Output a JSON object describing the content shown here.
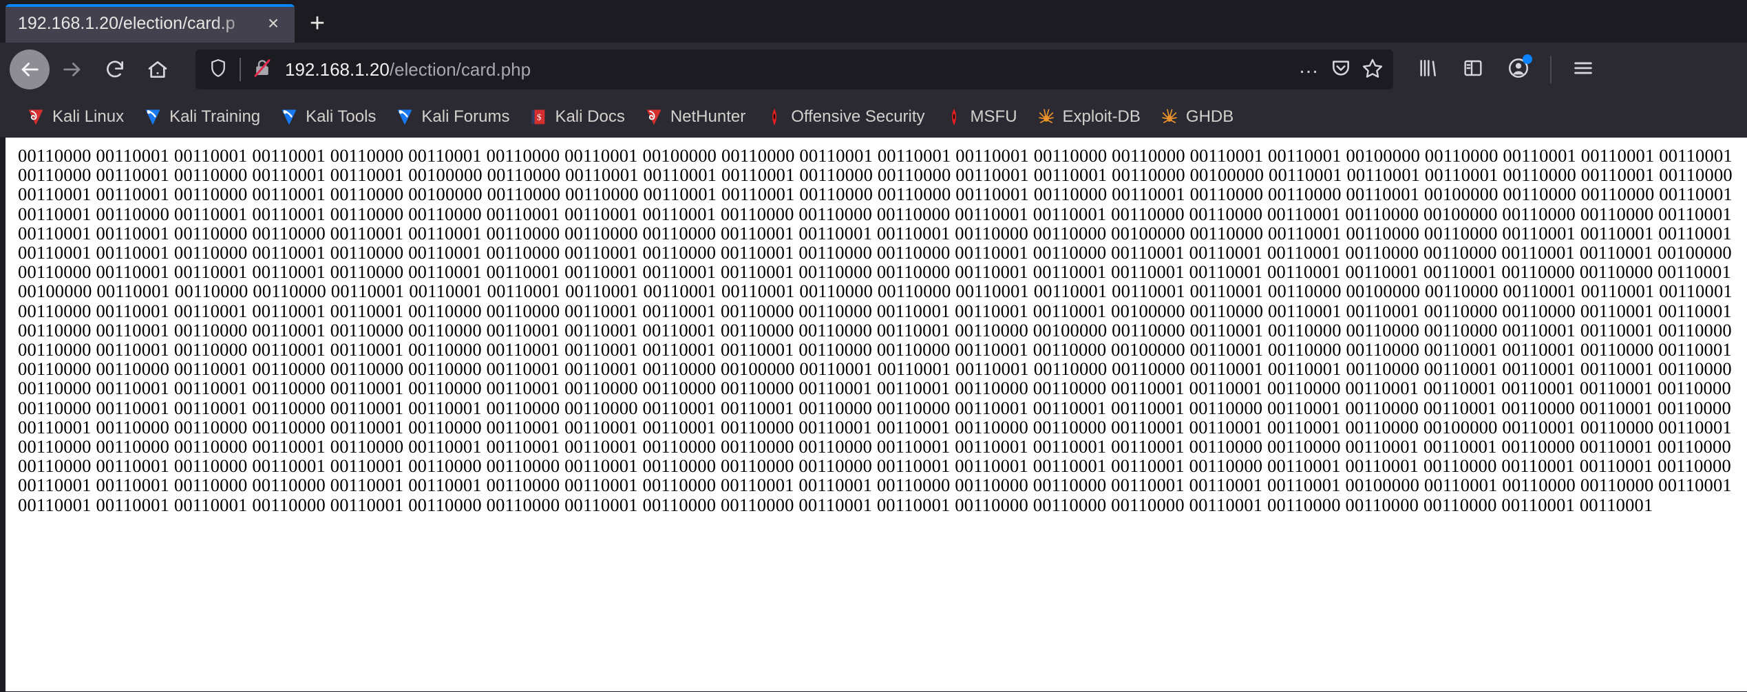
{
  "browser": {
    "tab": {
      "title": "192.168.1.20/election/card.p",
      "close_label": "×"
    },
    "new_tab_label": "+",
    "nav": {
      "back": "Back",
      "forward": "Forward",
      "reload": "Reload",
      "home": "Home"
    },
    "url": {
      "host": "192.168.1.20",
      "path": "/election/card.php",
      "page_actions_label": "…",
      "shield_icon": "shield-icon",
      "insecure_icon": "broken-lock-icon",
      "pocket_icon": "pocket-icon",
      "bookmark_icon": "star-icon"
    },
    "tools": {
      "library_icon": "library-icon",
      "sidebar_icon": "sidebar-icon",
      "account_icon": "account-avatar-icon",
      "menu_icon": "hamburger-menu-icon"
    },
    "accent_color": "#0a84ff",
    "chrome_color": "#2b2a33",
    "tab_color": "#42414d"
  },
  "bookmarks": [
    {
      "label": "Kali Linux",
      "icon": "kali-dragon-red-icon",
      "color": "#d32f2f"
    },
    {
      "label": "Kali Training",
      "icon": "kali-dragon-blue-icon",
      "color": "#1878f0"
    },
    {
      "label": "Kali Tools",
      "icon": "kali-dragon-blue-icon",
      "color": "#1878f0"
    },
    {
      "label": "Kali Forums",
      "icon": "kali-dragon-blue-icon",
      "color": "#1878f0"
    },
    {
      "label": "Kali Docs",
      "icon": "kali-docs-book-icon",
      "color": "#d32f2f"
    },
    {
      "label": "NetHunter",
      "icon": "kali-dragon-red-icon",
      "color": "#d32f2f"
    },
    {
      "label": "Offensive Security",
      "icon": "offsec-flame-icon",
      "color": "#e02020"
    },
    {
      "label": "MSFU",
      "icon": "offsec-flame-icon",
      "color": "#e02020"
    },
    {
      "label": "Exploit-DB",
      "icon": "exploitdb-spider-icon",
      "color": "#e8912a"
    },
    {
      "label": "GHDB",
      "icon": "exploitdb-spider-icon",
      "color": "#e8912a"
    }
  ],
  "page": {
    "content_type": "binary-text-dump",
    "text_color": "#000000",
    "background_color": "#ffffff",
    "binary_dump": "00110000 00110001 00110001 00110001 00110000 00110001 00110000 00110001 00100000 00110000 00110001 00110001 00110001 00110000 00110000 00110001 00110001 00100000 00110000 00110001 00110001 00110001 00110000 00110001 00110000 00110001 00110001 00100000 00110000 00110001 00110001 00110001 00110000 00110000 00110001 00110001 00110000 00100000 00110001 00110001 00110001 00110000 00110001 00110000 00110001 00110001 00110000 00110001 00110000 00100000 00110000 00110000 00110001 00110001 00110000 00110000 00110001 00110000 00110001 00110000 00110000 00110001 00100000 00110000 00110000 00110001 00110001 00110000 00110001 00110001 00110000 00110000 00110001 00110001 00110001 00110000 00110000 00110000 00110001 00110001 00110000 00110000 00110001 00110000 00100000 00110000 00110000 00110001 00110001 00110001 00110000 00110000 00110001 00110001 00110000 00110000 00110000 00110001 00110001 00110001 00110000 00110000 00100000 00110000 00110001 00110000 00110000 00110001 00110001 00110001 00110001 00110001 00110000 00110001 00110000 00110001 00110000 00110001 00110000 00110001 00110000 00110000 00110001 00110000 00110001 00110001 00110001 00110000 00110000 00110001 00110001 00100000 00110000 00110001 00110001 00110001 00110000 00110001 00110001 00110001 00110001 00110001 00110000 00110000 00110001 00110001 00110001 00110001 00110001 00110001 00110001 00110000 00110000 00110001 00100000 00110001 00110000 00110000 00110001 00110001 00110001 00110001 00110001 00110001 00110000 00110000 00110001 00110001 00110001 00110001 00110000 00100000 00110000 00110001 00110001 00110001 00110000 00110001 00110001 00110001 00110001 00110000 00110000 00110001 00110001 00110000 00110000 00110001 00110001 00110001 00100000 00110000 00110001 00110001 00110000 00110000 00110001 00110001 00110000 00110001 00110000 00110001 00110000 00110000 00110001 00110001 00110001 00110000 00110000 00110001 00110000 00100000 00110000 00110001 00110000 00110000 00110000 00110001 00110001 00110000 00110000 00110001 00110000 00110001 00110001 00110000 00110001 00110001 00110001 00110001 00110000 00110000 00110001 00110000 00100000 00110001 00110000 00110000 00110001 00110001 00110000 00110001 00110000 00110000 00110001 00110000 00110000 00110000 00110001 00110001 00110000 00100000 00110001 00110001 00110001 00110000 00110000 00110001 00110001 00110000 00110001 00110001 00110001 00110000 00110000 00110001 00110001 00110000 00110001 00110000 00110001 00110000 00110000 00110000 00110001 00110001 00110000 00110000 00110001 00110001 00110000 00110001 00110001 00110001 00110001 00110000 00110000 00110001 00110001 00110000 00110001 00110001 00110000 00110000 00110001 00110001 00110000 00110000 00110001 00110001 00110001 00110000 00110001 00110000 00110001 00110000 00110001 00110000 00110001 00110000 00110000 00110000 00110001 00110000 00110001 00110001 00110001 00110000 00110001 00110001 00110000 00110000 00110001 00110001 00110001 00110000 00100000 00110001 00110000 00110001 00110000 00110000 00110000 00110001 00110000 00110001 00110001 00110001 00110000 00110000 00110000 00110001 00110001 00110001 00110001 00110000 00110000 00110001 00110001 00110000 00110001 00110000 00110000 00110001 00110000 00110001 00110001 00110000 00110000 00110001 00110000 00110000 00110000 00110001 00110001 00110001 00110001 00110000 00110001 00110001 00110000 00110001 00110001 00110000 00110001 00110001 00110000 00110000 00110001 00110001 00110000 00110001 00110000 00110001 00110001 00110000 00110000 00110000 00110001 00110001 00110001 00100000 00110001 00110000 00110000 00110001 00110001 00110001 00110001 00110000 00110001 00110000 00110000 00110001 00110000 00110000 00110001 00110001 00110000 00110000 00110000 00110001 00110000 00110000 00110000 00110001 00110001"
  }
}
